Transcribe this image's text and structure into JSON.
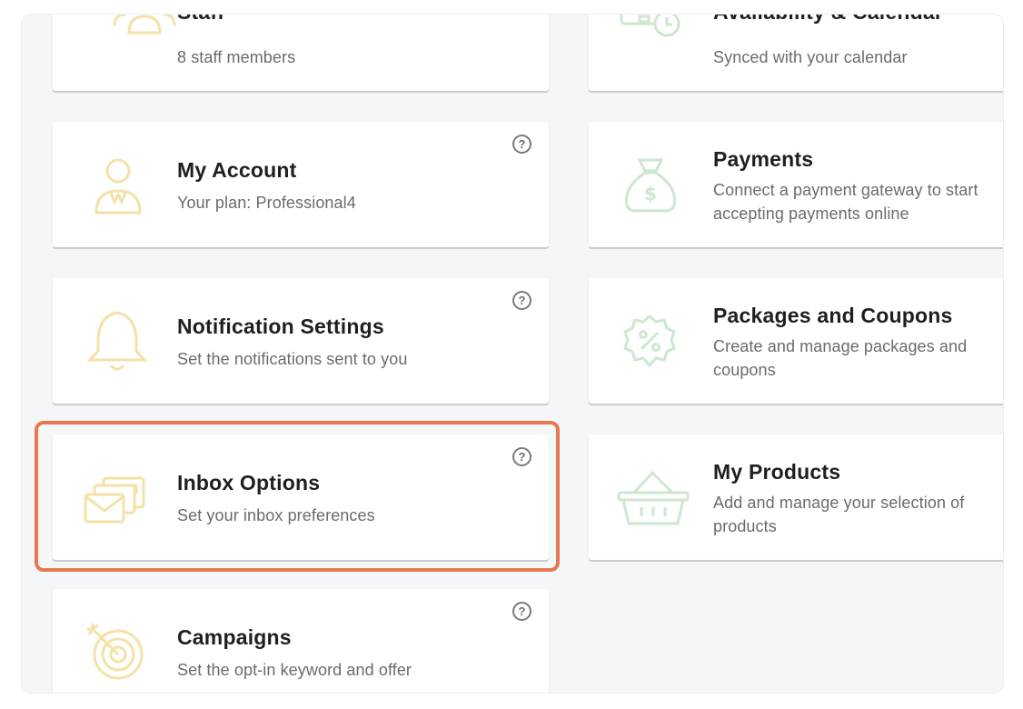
{
  "cards": {
    "staff": {
      "title": "Staff",
      "desc": "8 staff members"
    },
    "availability": {
      "title": "Availability & Calendar",
      "desc": "Synced with your calendar"
    },
    "my_account": {
      "title": "My Account",
      "desc": "Your plan: Professional4"
    },
    "payments": {
      "title": "Payments",
      "desc": "Connect a payment gateway to start accepting payments online"
    },
    "notifications": {
      "title": "Notification Settings",
      "desc": "Set the notifications sent to you"
    },
    "packages": {
      "title": "Packages and Coupons",
      "desc": "Create and manage packages and coupons"
    },
    "inbox": {
      "title": "Inbox Options",
      "desc": "Set your inbox preferences"
    },
    "products": {
      "title": "My Products",
      "desc": "Add and manage your selection of products"
    },
    "campaigns": {
      "title": "Campaigns",
      "desc": "Set the opt-in keyword and offer"
    }
  },
  "help_glyph": "?",
  "icons": {
    "staff": "staff-group-icon",
    "availability": "calendar-clock-icon",
    "my_account": "user-account-icon",
    "payments": "money-bag-icon",
    "notifications": "bell-icon",
    "packages": "discount-badge-icon",
    "inbox": "envelopes-icon",
    "products": "shopping-basket-icon",
    "campaigns": "target-icon"
  },
  "colors": {
    "yellow_icon": "#f3e2a8",
    "green_icon": "#cfe6cf",
    "highlight": "#e8784f"
  },
  "highlighted_card": "inbox"
}
